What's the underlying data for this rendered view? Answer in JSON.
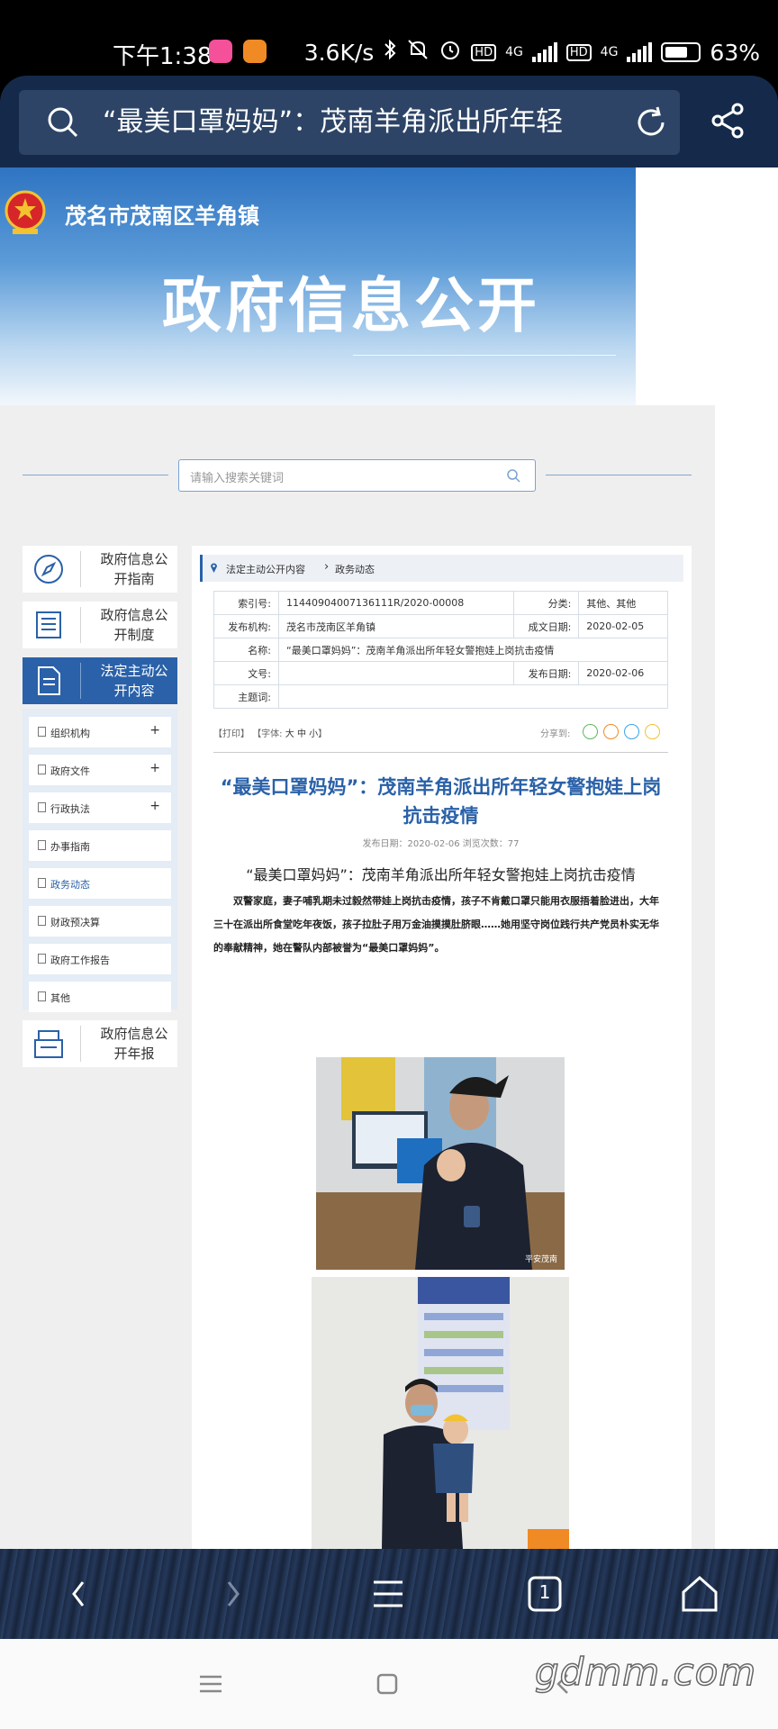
{
  "status_bar": {
    "time": "下午1:38",
    "net_speed": "3.6K/s",
    "network_1": "4G",
    "network_2": "4G",
    "battery": "63%"
  },
  "browser": {
    "url_text": "“最美口罩妈妈”：茂南羊角派出所年轻"
  },
  "banner": {
    "town": "茂名市茂南区羊角镇",
    "title": "政府信息公开"
  },
  "search": {
    "placeholder": "请输入搜索关键词"
  },
  "nav": {
    "guide": "政府信息公开指南",
    "system": "政府信息公开制度",
    "active": "法定主动公开内容",
    "report": "政府信息公开年报",
    "sub_items": [
      {
        "label": "组织机构",
        "expand": "+"
      },
      {
        "label": "政府文件",
        "expand": "+"
      },
      {
        "label": "行政执法",
        "expand": "+"
      },
      {
        "label": "办事指南"
      },
      {
        "label": "政务动态"
      },
      {
        "label": "财政预决算"
      },
      {
        "label": "政府工作报告"
      },
      {
        "label": "其他"
      }
    ]
  },
  "breadcrumb": {
    "level1": "法定主动公开内容",
    "level2": "政务动态"
  },
  "info": {
    "index_label": "索引号:",
    "index_value": "11440904007136111R/2020-00008",
    "category_label": "分类:",
    "category_value": "其他、其他",
    "publisher_label": "发布机构:",
    "publisher_value": "茂名市茂南区羊角镇",
    "created_label": "成文日期:",
    "created_value": "2020-02-05",
    "name_label": "名称:",
    "name_value": "“最美口罩妈妈”：茂南羊角派出所年轻女警抱娃上岗抗击疫情",
    "docno_label": "文号:",
    "docno_value": "",
    "published_label": "发布日期:",
    "published_value": "2020-02-06",
    "subject_label": "主题词:",
    "subject_value": ""
  },
  "tools": {
    "print": "【打印】",
    "font_prefix": "【字体:",
    "font_large": "大",
    "font_medium": "中",
    "font_small": "小",
    "font_suffix": "】",
    "share_label": "分享到:"
  },
  "article": {
    "title": "“最美口罩妈妈”：茂南羊角派出所年轻女警抱娃上岗抗击疫情",
    "meta": "发布日期：2020-02-06  浏览次数：77",
    "lead": "“最美口罩妈妈”：茂南羊角派出所年轻女警抱娃上岗抗击疫情",
    "body": "双警家庭，妻子哺乳期未过毅然带娃上岗抗击疫情，孩子不肯戴口罩只能用衣服捂着脸进出，大年三十在派出所食堂吃年夜饭，孩子拉肚子用万金油摸摸肚脐眼……她用坚守岗位践行共产党员朴实无华的奉献精神，她在警队内部被誉为“最美口罩妈妈”。",
    "watermark": "平安茂南"
  },
  "toolbar": {
    "tab_count": "1"
  },
  "site_mark": "gdmm.com",
  "colors": {
    "accent": "#2a61a8",
    "browser_bar": "#152a4a"
  }
}
